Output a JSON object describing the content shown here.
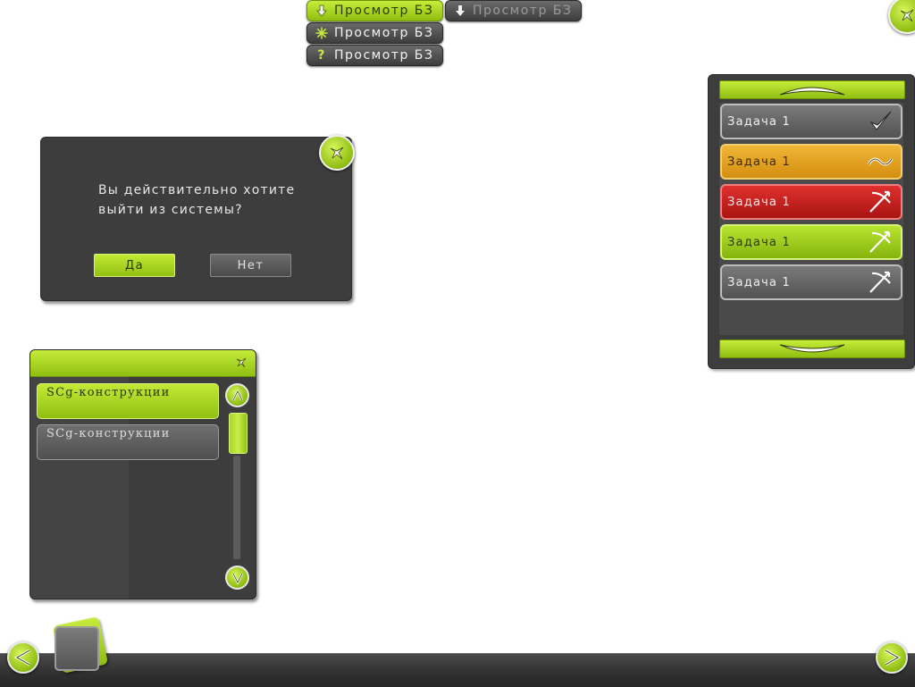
{
  "toolbar": {
    "buttons": [
      {
        "label": "Просмотр БЗ",
        "icon": "arrow-down-icon",
        "state": "active"
      },
      {
        "label": "Просмотр БЗ",
        "icon": "arrow-down-icon",
        "state": "inactive"
      },
      {
        "label": "Просмотр БЗ",
        "icon": "starburst-icon",
        "state": "normal"
      },
      {
        "label": "Просмотр БЗ",
        "icon": "question-icon",
        "state": "normal"
      }
    ]
  },
  "dialog": {
    "message_line1": "Вы действительно хотите",
    "message_line2": "выйти из системы?",
    "yes_label": "Да",
    "no_label": "Нет"
  },
  "task_panel": {
    "tasks": [
      {
        "label": "Задача 1",
        "status": "done",
        "icon": "checkmark-icon",
        "color": "#6a6a6a"
      },
      {
        "label": "Задача 1",
        "status": "in-progress",
        "icon": "tilde-icon",
        "color": "#e3a220"
      },
      {
        "label": "Задача 1",
        "status": "failed",
        "icon": "cross-arrow-icon",
        "color": "#c92220"
      },
      {
        "label": "Задача 1",
        "status": "active",
        "icon": "cross-arrow-icon",
        "color": "#a2d020"
      },
      {
        "label": "Задача 1",
        "status": "pending",
        "icon": "cross-arrow-icon",
        "color": "#6a6a6a"
      }
    ]
  },
  "scg_panel": {
    "items": [
      {
        "label": "SCg-конструкции",
        "selected": true
      },
      {
        "label": "SCg-конструкции",
        "selected": false
      }
    ]
  },
  "colors": {
    "accent": "#a2d020",
    "panel": "#3d3d3d"
  }
}
